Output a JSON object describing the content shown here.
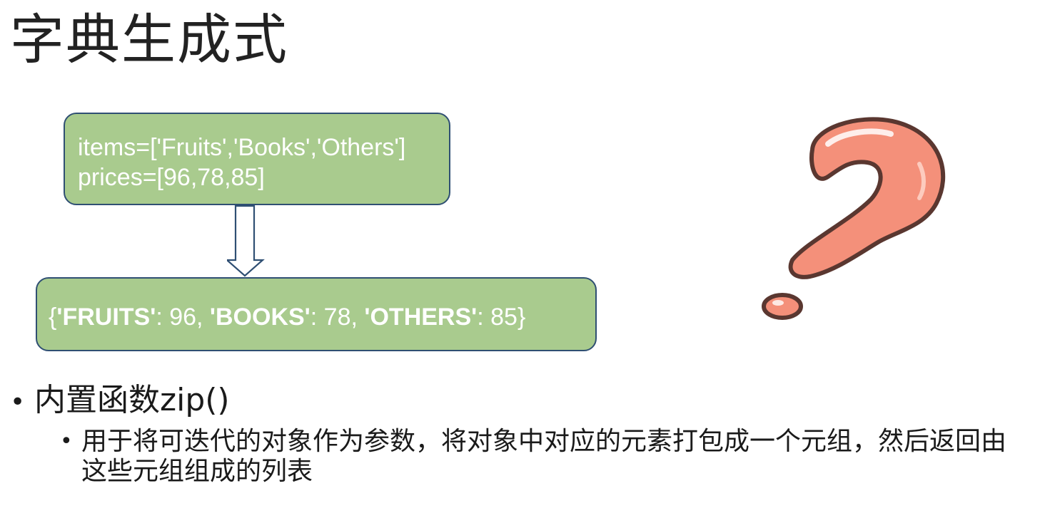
{
  "slide": {
    "title": "字典生成式"
  },
  "input_box": {
    "line1": "items=['Fruits','Books','Others']",
    "line2": "prices=[96,78,85]"
  },
  "output_box": {
    "open": "{",
    "key1": "'FRUITS'",
    "val1": ": 96, ",
    "key2": "'BOOKS'",
    "val2": ": 78, ",
    "key3": "'OTHERS'",
    "val3": ": 85",
    "close": "}"
  },
  "bullets": {
    "level1": "内置函数zip()",
    "level2": "用于将可迭代的对象作为参数，将对象中对应的元素打包成一个元组，然后返回由这些元组组成的列表"
  },
  "colors": {
    "box_fill": "#a9cb8e",
    "box_border": "#2f4f73",
    "arrow_border": "#2f4f73",
    "qmark_fill": "#f4907a",
    "qmark_outline": "#5a3730"
  },
  "icons": {
    "down_arrow": "hollow-down-arrow-icon",
    "question_mark": "question-mark-icon"
  }
}
